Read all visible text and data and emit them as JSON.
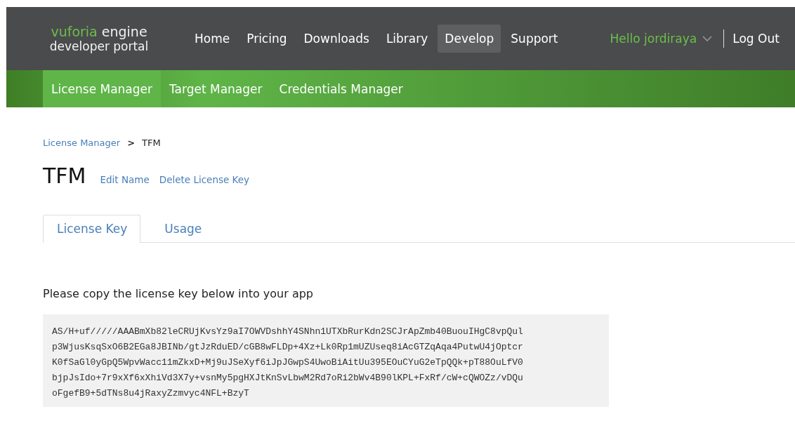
{
  "logo": {
    "brand": "vuforia",
    "product": "engine",
    "subtitle": "developer portal"
  },
  "nav": [
    {
      "label": "Home",
      "selected": false
    },
    {
      "label": "Pricing",
      "selected": false
    },
    {
      "label": "Downloads",
      "selected": false
    },
    {
      "label": "Library",
      "selected": false
    },
    {
      "label": "Develop",
      "selected": true
    },
    {
      "label": "Support",
      "selected": false
    }
  ],
  "user_menu": {
    "greeting": "Hello jordiraya",
    "logout": "Log Out"
  },
  "subnav": [
    {
      "label": "License Manager",
      "selected": true
    },
    {
      "label": "Target Manager",
      "selected": false
    },
    {
      "label": "Credentials Manager",
      "selected": false
    }
  ],
  "breadcrumb": {
    "parent": "License Manager",
    "separator": ">",
    "current": "TFM"
  },
  "title": "TFM",
  "title_actions": [
    "Edit Name",
    "Delete License Key"
  ],
  "tabs": [
    {
      "label": "License Key",
      "selected": true
    },
    {
      "label": "Usage",
      "selected": false
    }
  ],
  "instructions": "Please copy the license key below into your app",
  "license_key_lines": [
    "AS/H+uf/////AAABmXb82leCRUjKvsYz9aI7OWVDshhY4SNhn1UTXbRurKdn2SCJrApZmb40BuouIHgC8vpQul",
    "p3WjusKsqSxO6B2EGa8JBINb/gtJzRduED/cGB8wFLDp+4Xz+Lk0Rp1mUZUseq8iAcGTZqAqa4PutwU4jOptcr",
    "K0fSaGl0yGpQ5WpvWacc11mZkxD+Mj9uJSeXyf6iJpJGwpS4UwoBiAitUu395EOuCYuG2eTpQQk+pT88OuLfV0",
    "bjpJsIdo+7r9xXf6xXhiVd3X7y+vsnMy5pgHXJtKnSvLbwM2Rd7oRi2bWv4B90lKPL+FxRf/cW+cQWOZz/vDQu",
    "oFgefB9+5dTNs8u4jRaxyZzmvyc4NFL+BzyT"
  ]
}
